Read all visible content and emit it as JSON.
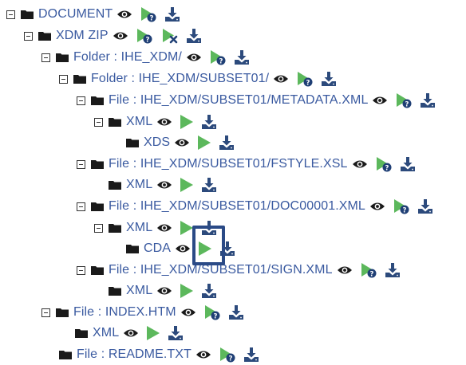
{
  "colors": {
    "text": "#3a5aa0",
    "icon_dark": "#1a1a1a",
    "play_green": "#5cb85c",
    "download_blue": "#2c4a7c",
    "badge_blue": "#1f3f75",
    "highlight": "#2a4a86"
  },
  "icons": {
    "collapse": "minus-square-icon",
    "folder": "folder-icon",
    "view": "eye-icon",
    "validate": "play-with-badge-icon",
    "validate_error": "play-with-x-icon",
    "render": "play-icon",
    "download": "download-icon"
  },
  "tree": [
    {
      "label": "DOCUMENT",
      "collapsible": true,
      "action": "validate"
    },
    {
      "label": "XDM ZIP",
      "collapsible": true,
      "action": "validate_error"
    },
    {
      "label": "Folder : IHE_XDM/",
      "collapsible": true,
      "action": "validate"
    },
    {
      "label": "Folder : IHE_XDM/SUBSET01/",
      "collapsible": true,
      "action": "validate"
    },
    {
      "label": "File : IHE_XDM/SUBSET01/METADATA.XML",
      "collapsible": true,
      "action": "validate"
    },
    {
      "label": "XML",
      "collapsible": true,
      "action": "render"
    },
    {
      "label": "XDS",
      "collapsible": false,
      "action": "render"
    },
    {
      "label": "File : IHE_XDM/SUBSET01/FSTYLE.XSL",
      "collapsible": true,
      "action": "validate"
    },
    {
      "label": "XML",
      "collapsible": false,
      "action": "render"
    },
    {
      "label": "File : IHE_XDM/SUBSET01/DOC00001.XML",
      "collapsible": true,
      "action": "validate"
    },
    {
      "label": "XML",
      "collapsible": true,
      "action": "render"
    },
    {
      "label": "CDA",
      "collapsible": false,
      "action": "render"
    },
    {
      "label": "File : IHE_XDM/SUBSET01/SIGN.XML",
      "collapsible": true,
      "action": "validate"
    },
    {
      "label": "XML",
      "collapsible": false,
      "action": "render"
    },
    {
      "label": "File : INDEX.HTM",
      "collapsible": true,
      "action": "validate"
    },
    {
      "label": "XML",
      "collapsible": false,
      "action": "render"
    },
    {
      "label": "File : README.TXT",
      "collapsible": false,
      "action": "validate"
    }
  ]
}
